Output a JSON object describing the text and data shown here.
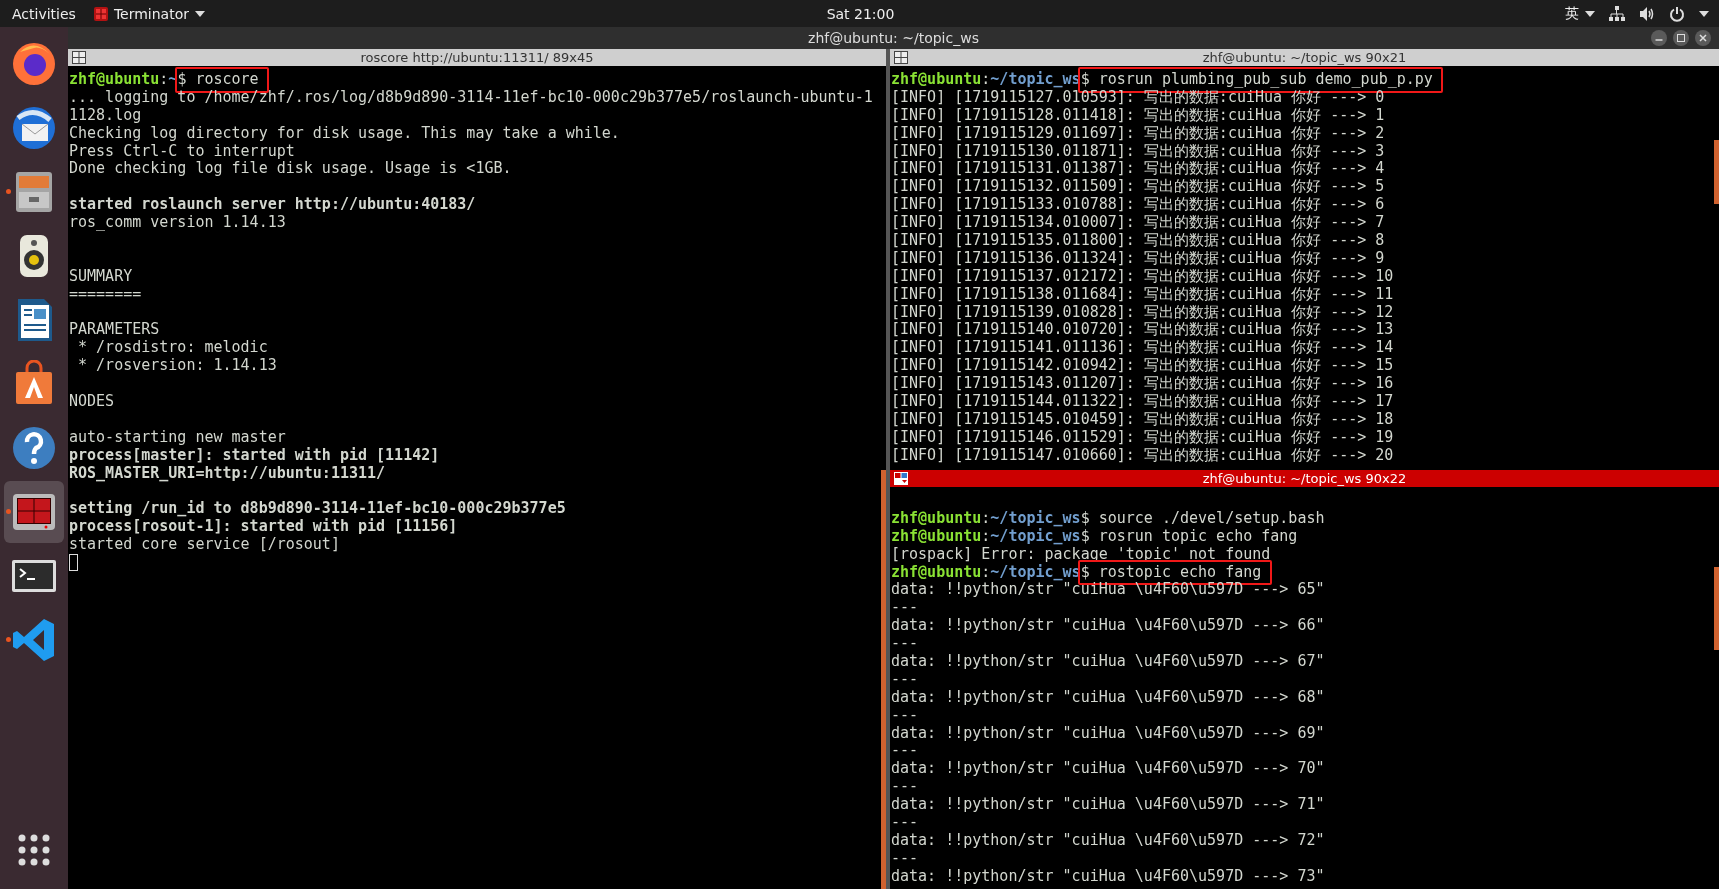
{
  "top_bar": {
    "activities": "Activities",
    "app_menu": "Terminator",
    "clock": "Sat 21:00",
    "input_method": "英"
  },
  "dock": [
    {
      "kind": "browser",
      "running": false,
      "selected": false
    },
    {
      "kind": "mail",
      "running": false,
      "selected": false
    },
    {
      "kind": "files",
      "running": true,
      "selected": false
    },
    {
      "kind": "music",
      "running": false,
      "selected": false
    },
    {
      "kind": "writer",
      "running": false,
      "selected": false
    },
    {
      "kind": "store",
      "running": false,
      "selected": false
    },
    {
      "kind": "help",
      "running": false,
      "selected": false
    },
    {
      "kind": "terminator",
      "running": true,
      "selected": true
    },
    {
      "kind": "terminal",
      "running": false,
      "selected": false
    },
    {
      "kind": "editor",
      "running": true,
      "selected": false
    },
    {
      "kind": "apps",
      "running": false,
      "selected": false
    }
  ],
  "window": {
    "title": "zhf@ubuntu: ~/topic_ws",
    "panes": [
      {
        "title": "roscore http://ubuntu:11311/ 89x45",
        "focused": false,
        "cursor": true,
        "lines": [
          {
            "kind": "prompt",
            "user": "zhf@ubuntu",
            "sep": ":",
            "path": "~",
            "sign": "$",
            "command": "roscore",
            "highlighted": true
          },
          {
            "kind": "output",
            "text": "... logging to /home/zhf/.ros/log/d8b9d890-3114-11ef-bc10-000c29b377e5/roslaunch-ubuntu-1"
          },
          {
            "kind": "output",
            "text": "1128.log"
          },
          {
            "kind": "output",
            "text": "Checking log directory for disk usage. This may take a while."
          },
          {
            "kind": "output",
            "text": "Press Ctrl-C to interrupt"
          },
          {
            "kind": "output",
            "text": "Done checking log file disk usage. Usage is <1GB."
          },
          {
            "kind": "blank"
          },
          {
            "kind": "bold",
            "text": "started roslaunch server http://ubuntu:40183/"
          },
          {
            "kind": "output",
            "text": "ros_comm version 1.14.13"
          },
          {
            "kind": "blank"
          },
          {
            "kind": "blank"
          },
          {
            "kind": "output",
            "text": "SUMMARY"
          },
          {
            "kind": "output",
            "text": "========"
          },
          {
            "kind": "blank"
          },
          {
            "kind": "output",
            "text": "PARAMETERS"
          },
          {
            "kind": "output",
            "text": " * /rosdistro: melodic"
          },
          {
            "kind": "output",
            "text": " * /rosversion: 1.14.13"
          },
          {
            "kind": "blank"
          },
          {
            "kind": "output",
            "text": "NODES"
          },
          {
            "kind": "blank"
          },
          {
            "kind": "output",
            "text": "auto-starting new master"
          },
          {
            "kind": "bold",
            "text": "process[master]: started with pid [11142]"
          },
          {
            "kind": "bold",
            "text": "ROS_MASTER_URI=http://ubuntu:11311/"
          },
          {
            "kind": "blank"
          },
          {
            "kind": "bold",
            "text": "setting /run_id to d8b9d890-3114-11ef-bc10-000c29b377e5"
          },
          {
            "kind": "bold",
            "text": "process[rosout-1]: started with pid [11156]"
          },
          {
            "kind": "output",
            "text": "started core service [/rosout]"
          }
        ]
      },
      {
        "title": "zhf@ubuntu: ~/topic_ws 90x21",
        "focused": false,
        "lines": [
          {
            "kind": "prompt",
            "user": "zhf@ubuntu",
            "sep": ":",
            "path": "~/topic_ws",
            "sign": "$",
            "command": "rosrun plumbing_pub_sub demo_pub_p.py",
            "highlighted": true
          },
          {
            "kind": "output",
            "text": "[INFO] [1719115127.010593]: 写出的数据:cuiHua 你好 ---> 0"
          },
          {
            "kind": "output",
            "text": "[INFO] [1719115128.011418]: 写出的数据:cuiHua 你好 ---> 1"
          },
          {
            "kind": "output",
            "text": "[INFO] [1719115129.011697]: 写出的数据:cuiHua 你好 ---> 2"
          },
          {
            "kind": "output",
            "text": "[INFO] [1719115130.011871]: 写出的数据:cuiHua 你好 ---> 3"
          },
          {
            "kind": "output",
            "text": "[INFO] [1719115131.011387]: 写出的数据:cuiHua 你好 ---> 4"
          },
          {
            "kind": "output",
            "text": "[INFO] [1719115132.011509]: 写出的数据:cuiHua 你好 ---> 5"
          },
          {
            "kind": "output",
            "text": "[INFO] [1719115133.010788]: 写出的数据:cuiHua 你好 ---> 6"
          },
          {
            "kind": "output",
            "text": "[INFO] [1719115134.010007]: 写出的数据:cuiHua 你好 ---> 7"
          },
          {
            "kind": "output",
            "text": "[INFO] [1719115135.011800]: 写出的数据:cuiHua 你好 ---> 8"
          },
          {
            "kind": "output",
            "text": "[INFO] [1719115136.011324]: 写出的数据:cuiHua 你好 ---> 9"
          },
          {
            "kind": "output",
            "text": "[INFO] [1719115137.012172]: 写出的数据:cuiHua 你好 ---> 10"
          },
          {
            "kind": "output",
            "text": "[INFO] [1719115138.011684]: 写出的数据:cuiHua 你好 ---> 11"
          },
          {
            "kind": "output",
            "text": "[INFO] [1719115139.010828]: 写出的数据:cuiHua 你好 ---> 12"
          },
          {
            "kind": "output",
            "text": "[INFO] [1719115140.010720]: 写出的数据:cuiHua 你好 ---> 13"
          },
          {
            "kind": "output",
            "text": "[INFO] [1719115141.011136]: 写出的数据:cuiHua 你好 ---> 14"
          },
          {
            "kind": "output",
            "text": "[INFO] [1719115142.010942]: 写出的数据:cuiHua 你好 ---> 15"
          },
          {
            "kind": "output",
            "text": "[INFO] [1719115143.011207]: 写出的数据:cuiHua 你好 ---> 16"
          },
          {
            "kind": "output",
            "text": "[INFO] [1719115144.011322]: 写出的数据:cuiHua 你好 ---> 17"
          },
          {
            "kind": "output",
            "text": "[INFO] [1719115145.010459]: 写出的数据:cuiHua 你好 ---> 18"
          },
          {
            "kind": "output",
            "text": "[INFO] [1719115146.011529]: 写出的数据:cuiHua 你好 ---> 19"
          },
          {
            "kind": "output",
            "text": "[INFO] [1719115147.010660]: 写出的数据:cuiHua 你好 ---> 20"
          }
        ]
      },
      {
        "title": "zhf@ubuntu: ~/topic_ws 90x22",
        "focused": true,
        "lines": [
          {
            "kind": "blank"
          },
          {
            "kind": "prompt",
            "user": "zhf@ubuntu",
            "sep": ":",
            "path": "~/topic_ws",
            "sign": "$",
            "command": "source ./devel/setup.bash",
            "highlighted": false
          },
          {
            "kind": "prompt",
            "user": "zhf@ubuntu",
            "sep": ":",
            "path": "~/topic_ws",
            "sign": "$",
            "command": "rosrun topic echo fang",
            "highlighted": false
          },
          {
            "kind": "output",
            "text": "[rospack] Error: package 'topic' not found"
          },
          {
            "kind": "prompt",
            "user": "zhf@ubuntu",
            "sep": ":",
            "path": "~/topic_ws",
            "sign": "$",
            "command": "rostopic echo fang",
            "highlighted": true
          },
          {
            "kind": "output",
            "text": "data: !!python/str \"cuiHua \\u4F60\\u597D ---> 65\""
          },
          {
            "kind": "output",
            "text": "---"
          },
          {
            "kind": "output",
            "text": "data: !!python/str \"cuiHua \\u4F60\\u597D ---> 66\""
          },
          {
            "kind": "output",
            "text": "---"
          },
          {
            "kind": "output",
            "text": "data: !!python/str \"cuiHua \\u4F60\\u597D ---> 67\""
          },
          {
            "kind": "output",
            "text": "---"
          },
          {
            "kind": "output",
            "text": "data: !!python/str \"cuiHua \\u4F60\\u597D ---> 68\""
          },
          {
            "kind": "output",
            "text": "---"
          },
          {
            "kind": "output",
            "text": "data: !!python/str \"cuiHua \\u4F60\\u597D ---> 69\""
          },
          {
            "kind": "output",
            "text": "---"
          },
          {
            "kind": "output",
            "text": "data: !!python/str \"cuiHua \\u4F60\\u597D ---> 70\""
          },
          {
            "kind": "output",
            "text": "---"
          },
          {
            "kind": "output",
            "text": "data: !!python/str \"cuiHua \\u4F60\\u597D ---> 71\""
          },
          {
            "kind": "output",
            "text": "---"
          },
          {
            "kind": "output",
            "text": "data: !!python/str \"cuiHua \\u4F60\\u597D ---> 72\""
          },
          {
            "kind": "output",
            "text": "---"
          },
          {
            "kind": "output",
            "text": "data: !!python/str \"cuiHua \\u4F60\\u597D ---> 73\""
          }
        ]
      }
    ]
  }
}
